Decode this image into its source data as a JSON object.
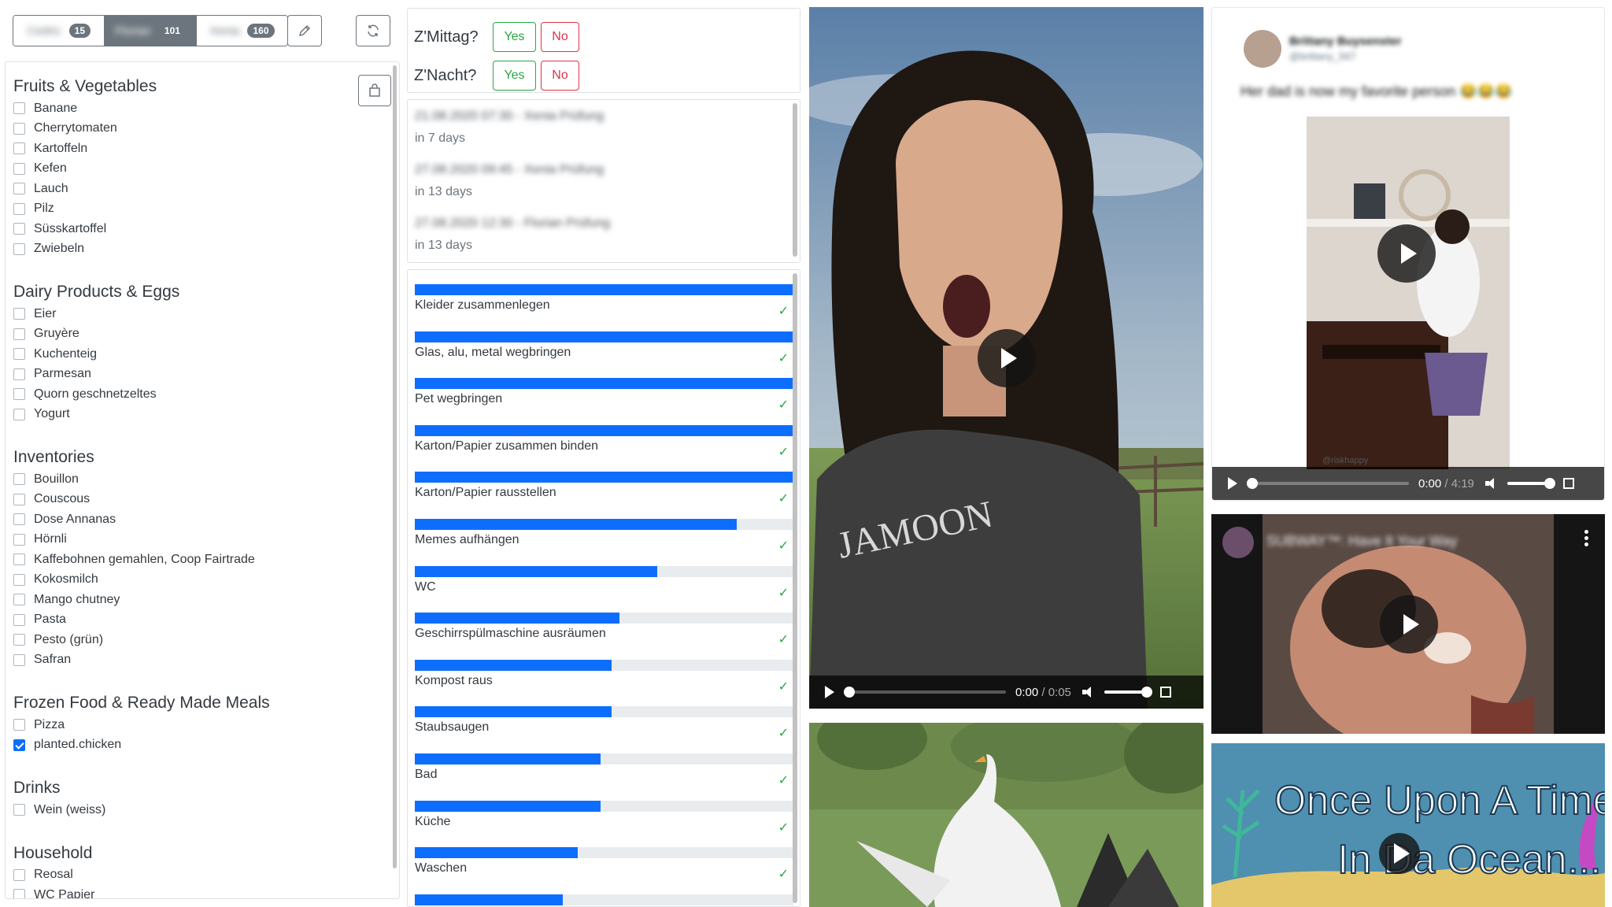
{
  "tabs": [
    {
      "label": "Cedric",
      "count": "15",
      "active": false
    },
    {
      "label": "Florian",
      "count": "101",
      "active": true
    },
    {
      "label": "Xenia",
      "count": "160",
      "active": false
    }
  ],
  "categories": [
    {
      "title": "Fruits & Vegetables",
      "items": [
        {
          "label": "Banane",
          "checked": false
        },
        {
          "label": "Cherrytomaten",
          "checked": false
        },
        {
          "label": "Kartoffeln",
          "checked": false
        },
        {
          "label": "Kefen",
          "checked": false
        },
        {
          "label": "Lauch",
          "checked": false
        },
        {
          "label": "Pilz",
          "checked": false
        },
        {
          "label": "Süsskartoffel",
          "checked": false
        },
        {
          "label": "Zwiebeln",
          "checked": false
        }
      ]
    },
    {
      "title": "Dairy Products & Eggs",
      "items": [
        {
          "label": "Eier",
          "checked": false
        },
        {
          "label": "Gruyère",
          "checked": false
        },
        {
          "label": "Kuchenteig",
          "checked": false
        },
        {
          "label": "Parmesan",
          "checked": false
        },
        {
          "label": "Quorn geschnetzeltes",
          "checked": false
        },
        {
          "label": "Yogurt",
          "checked": false
        }
      ]
    },
    {
      "title": "Inventories",
      "items": [
        {
          "label": "Bouillon",
          "checked": false
        },
        {
          "label": "Couscous",
          "checked": false
        },
        {
          "label": "Dose Annanas",
          "checked": false
        },
        {
          "label": "Hörnli",
          "checked": false
        },
        {
          "label": "Kaffebohnen gemahlen, Coop Fairtrade",
          "checked": false
        },
        {
          "label": "Kokosmilch",
          "checked": false
        },
        {
          "label": "Mango chutney",
          "checked": false
        },
        {
          "label": "Pasta",
          "checked": false
        },
        {
          "label": "Pesto (grün)",
          "checked": false
        },
        {
          "label": "Safran",
          "checked": false
        }
      ]
    },
    {
      "title": "Frozen Food & Ready Made Meals",
      "items": [
        {
          "label": "Pizza",
          "checked": false
        },
        {
          "label": "planted.chicken",
          "checked": true
        }
      ]
    },
    {
      "title": "Drinks",
      "items": [
        {
          "label": "Wein (weiss)",
          "checked": false
        }
      ]
    },
    {
      "title": "Household",
      "items": [
        {
          "label": "Reosal",
          "checked": false
        },
        {
          "label": "WC Papier",
          "checked": false
        }
      ]
    }
  ],
  "meals": [
    {
      "question": "Z'Mittag?",
      "yes": "Yes",
      "no": "No"
    },
    {
      "question": "Z'Nacht?",
      "yes": "Yes",
      "no": "No"
    }
  ],
  "events": [
    {
      "title": "21.08.2020 07:30 - Xenia Prüfung",
      "relative": "in 7 days"
    },
    {
      "title": "27.08.2020 09:45 - Xenia Prüfung",
      "relative": "in 13 days"
    },
    {
      "title": "27.08.2020 12:30 - Florian Prüfung",
      "relative": "in 13 days"
    }
  ],
  "tasks": [
    {
      "label": "Kleider zusammenlegen",
      "progress": 1.0
    },
    {
      "label": "Glas, alu, metal wegbringen",
      "progress": 1.0
    },
    {
      "label": "Pet wegbringen",
      "progress": 1.0
    },
    {
      "label": "Karton/Papier zusammen binden",
      "progress": 1.0
    },
    {
      "label": "Karton/Papier rausstellen",
      "progress": 1.0
    },
    {
      "label": "Memes aufhängen",
      "progress": 0.85
    },
    {
      "label": "WC",
      "progress": 0.64
    },
    {
      "label": "Geschirrspülmaschine ausräumen",
      "progress": 0.54
    },
    {
      "label": "Kompost raus",
      "progress": 0.52
    },
    {
      "label": "Staubsaugen",
      "progress": 0.52
    },
    {
      "label": "Bad",
      "progress": 0.49
    },
    {
      "label": "Küche",
      "progress": 0.49
    },
    {
      "label": "Waschen",
      "progress": 0.43
    },
    {
      "label": "",
      "progress": 0.39
    }
  ],
  "check_glyph": "✓",
  "video_main": {
    "current": "0:00",
    "duration": "/ 0:05",
    "progress": 0.0,
    "volume": 1.0
  },
  "tweet": {
    "author": "Brittany Buysenster",
    "handle": "@brittany_567",
    "text": "Her dad is now my favorite person 😂😂😂",
    "watermark": "@riskhappy"
  },
  "video_tweet": {
    "current": "0:00",
    "duration": "/ 4:19",
    "progress": 0.0,
    "volume": 1.0
  },
  "youtube": {
    "title": "SUBWAY™: Have It Your Way"
  },
  "ocean": {
    "text": "Once Upon A Time In Da Ocean..."
  }
}
